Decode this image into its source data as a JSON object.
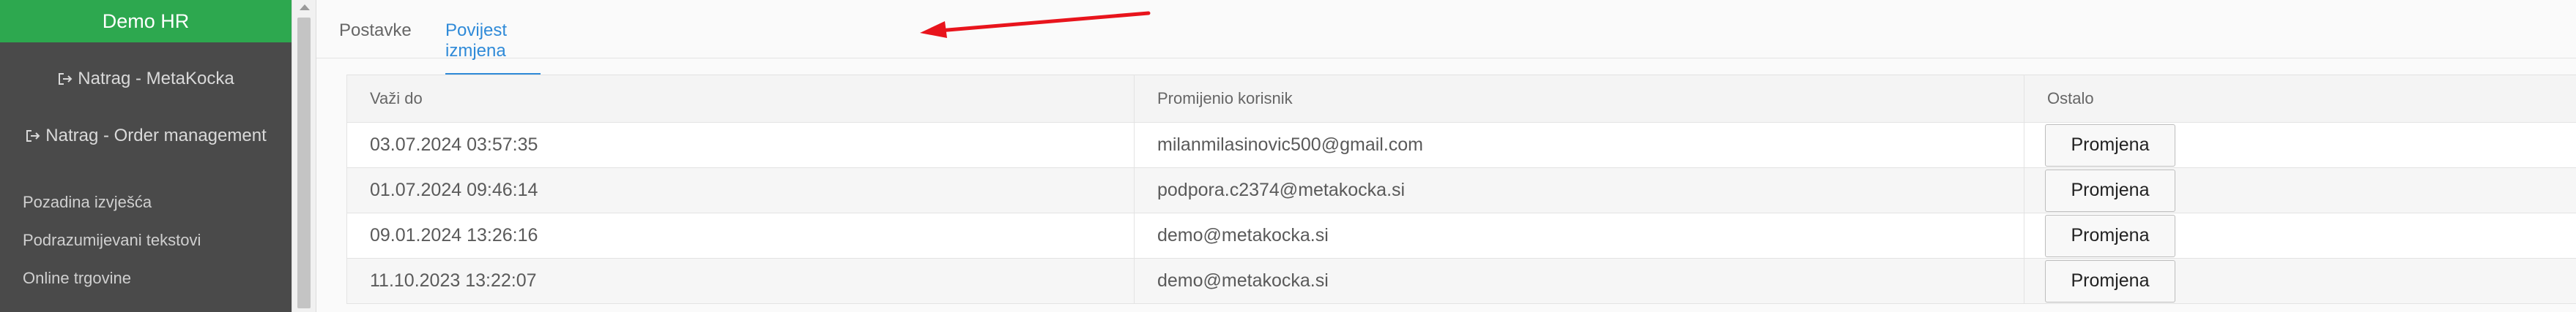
{
  "sidebar": {
    "brand": "Demo HR",
    "back_links": [
      {
        "label": "Natrag - MetaKocka",
        "icon": "sign-out-icon"
      },
      {
        "label": "Natrag - Order management",
        "icon": "sign-out-icon"
      }
    ],
    "links": [
      {
        "label": "Pozadina izvješća"
      },
      {
        "label": "Podrazumijevani tekstovi"
      },
      {
        "label": "Online trgovine"
      }
    ]
  },
  "tabs": [
    {
      "label": "Postavke",
      "active": false
    },
    {
      "label": "Povijest izmjena",
      "active": true
    }
  ],
  "table": {
    "columns": [
      "Važi do",
      "Promijenio korisnik",
      "Ostalo"
    ],
    "rows": [
      {
        "valid_until": "03.07.2024 03:57:35",
        "user": "milanmilasinovic500@gmail.com",
        "action": "Promjena"
      },
      {
        "valid_until": "01.07.2024 09:46:14",
        "user": "podpora.c2374@metakocka.si",
        "action": "Promjena"
      },
      {
        "valid_until": "09.01.2024 13:26:16",
        "user": "demo@metakocka.si",
        "action": "Promjena"
      },
      {
        "valid_until": "11.10.2023 13:22:07",
        "user": "demo@metakocka.si",
        "action": "Promjena"
      }
    ]
  },
  "colors": {
    "brand_green": "#2da84f",
    "sidebar_bg": "#4a4a4a",
    "active_tab": "#2f8ad8",
    "annotation_arrow": "#e8141c"
  }
}
